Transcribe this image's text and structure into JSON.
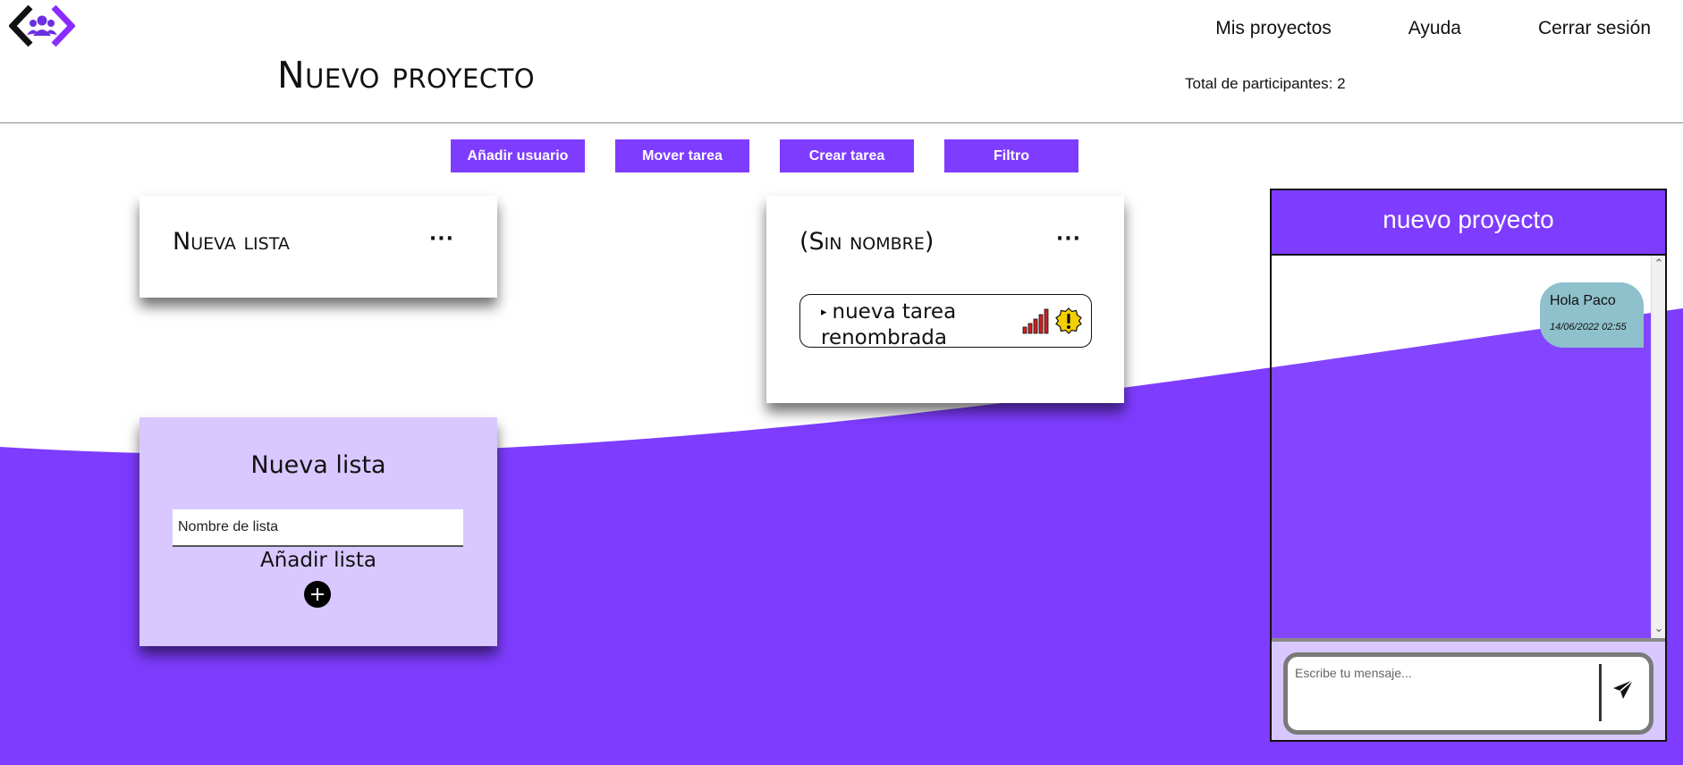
{
  "colors": {
    "accent": "#7e3cff",
    "accent_light": "#d8c8ff",
    "bubble": "#8ec1cc"
  },
  "nav": {
    "logo_icon": "group-code-logo-icon",
    "items": [
      {
        "label": "Mis proyectos"
      },
      {
        "label": "Ayuda"
      },
      {
        "label": "Cerrar sesión"
      }
    ]
  },
  "header": {
    "title": "Nuevo proyecto",
    "participants": "Total de participantes: 2"
  },
  "toolbar": {
    "add_user": "Añadir usuario",
    "move_task": "Mover tarea",
    "create_task": "Crear tarea",
    "filter": "Filtro"
  },
  "lists": [
    {
      "title": "Nueva lista",
      "menu": "···",
      "tasks": []
    },
    {
      "title": "(Sin nombre)",
      "menu": "···",
      "tasks": [
        {
          "label": "nueva tarea renombrada",
          "priority_icon": "signal-bars-icon",
          "status_icon": "warning-icon"
        }
      ]
    }
  ],
  "new_list": {
    "title": "Nueva lista",
    "input_placeholder": "Nombre de lista",
    "add_label": "Añadir lista"
  },
  "chat": {
    "title": "nuevo proyecto",
    "messages": [
      {
        "text": "Hola Paco",
        "time": "14/06/2022 02:55"
      }
    ],
    "input_placeholder": "Escribe tu mensaje...",
    "send_icon": "send-icon"
  }
}
